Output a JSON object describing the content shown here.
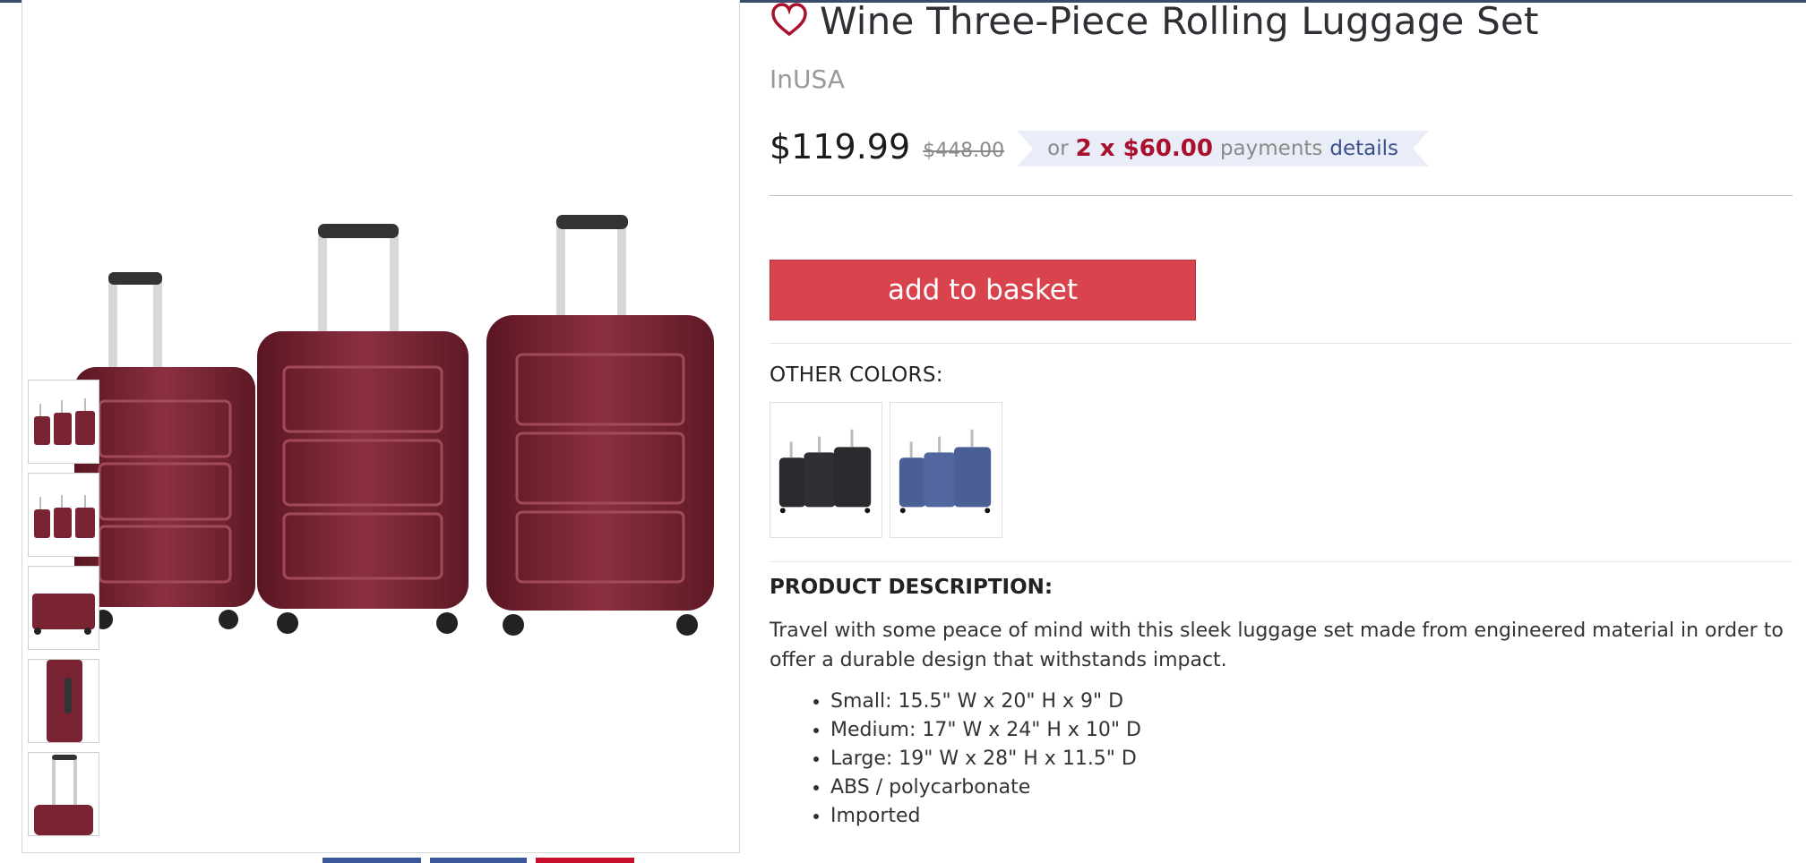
{
  "product": {
    "title": "Wine Three-Piece Rolling Luggage Set",
    "brand": "InUSA",
    "price": "$119.99",
    "original_price": "$448.00",
    "payment": {
      "prefix": "or",
      "amount": "2 x $60.00",
      "word": "payments",
      "link": "details"
    }
  },
  "actions": {
    "add_to_basket": "add to basket"
  },
  "other_colors": {
    "heading": "OTHER COLORS:",
    "swatches": [
      "black",
      "blue"
    ]
  },
  "description": {
    "heading": "PRODUCT DESCRIPTION:",
    "text": "Travel with some peace of mind with this sleek luggage set made from engineered material in order to offer a durable design that withstands impact.",
    "bullets": [
      "Small: 15.5\" W x 20\" H x 9\" D",
      "Medium: 17\" W x 24\" H x 10\" D",
      "Large: 19\" W x 28\" H x 11.5\" D",
      "ABS / polycarbonate",
      "Imported"
    ]
  },
  "colors": {
    "accent_red": "#d9434e",
    "price_red": "#a8102e",
    "link_blue": "#3c4f8a",
    "banner_bg": "#e9edf7",
    "luggage_wine": "#7a2433"
  },
  "gallery": {
    "thumbnail_count": 5
  }
}
